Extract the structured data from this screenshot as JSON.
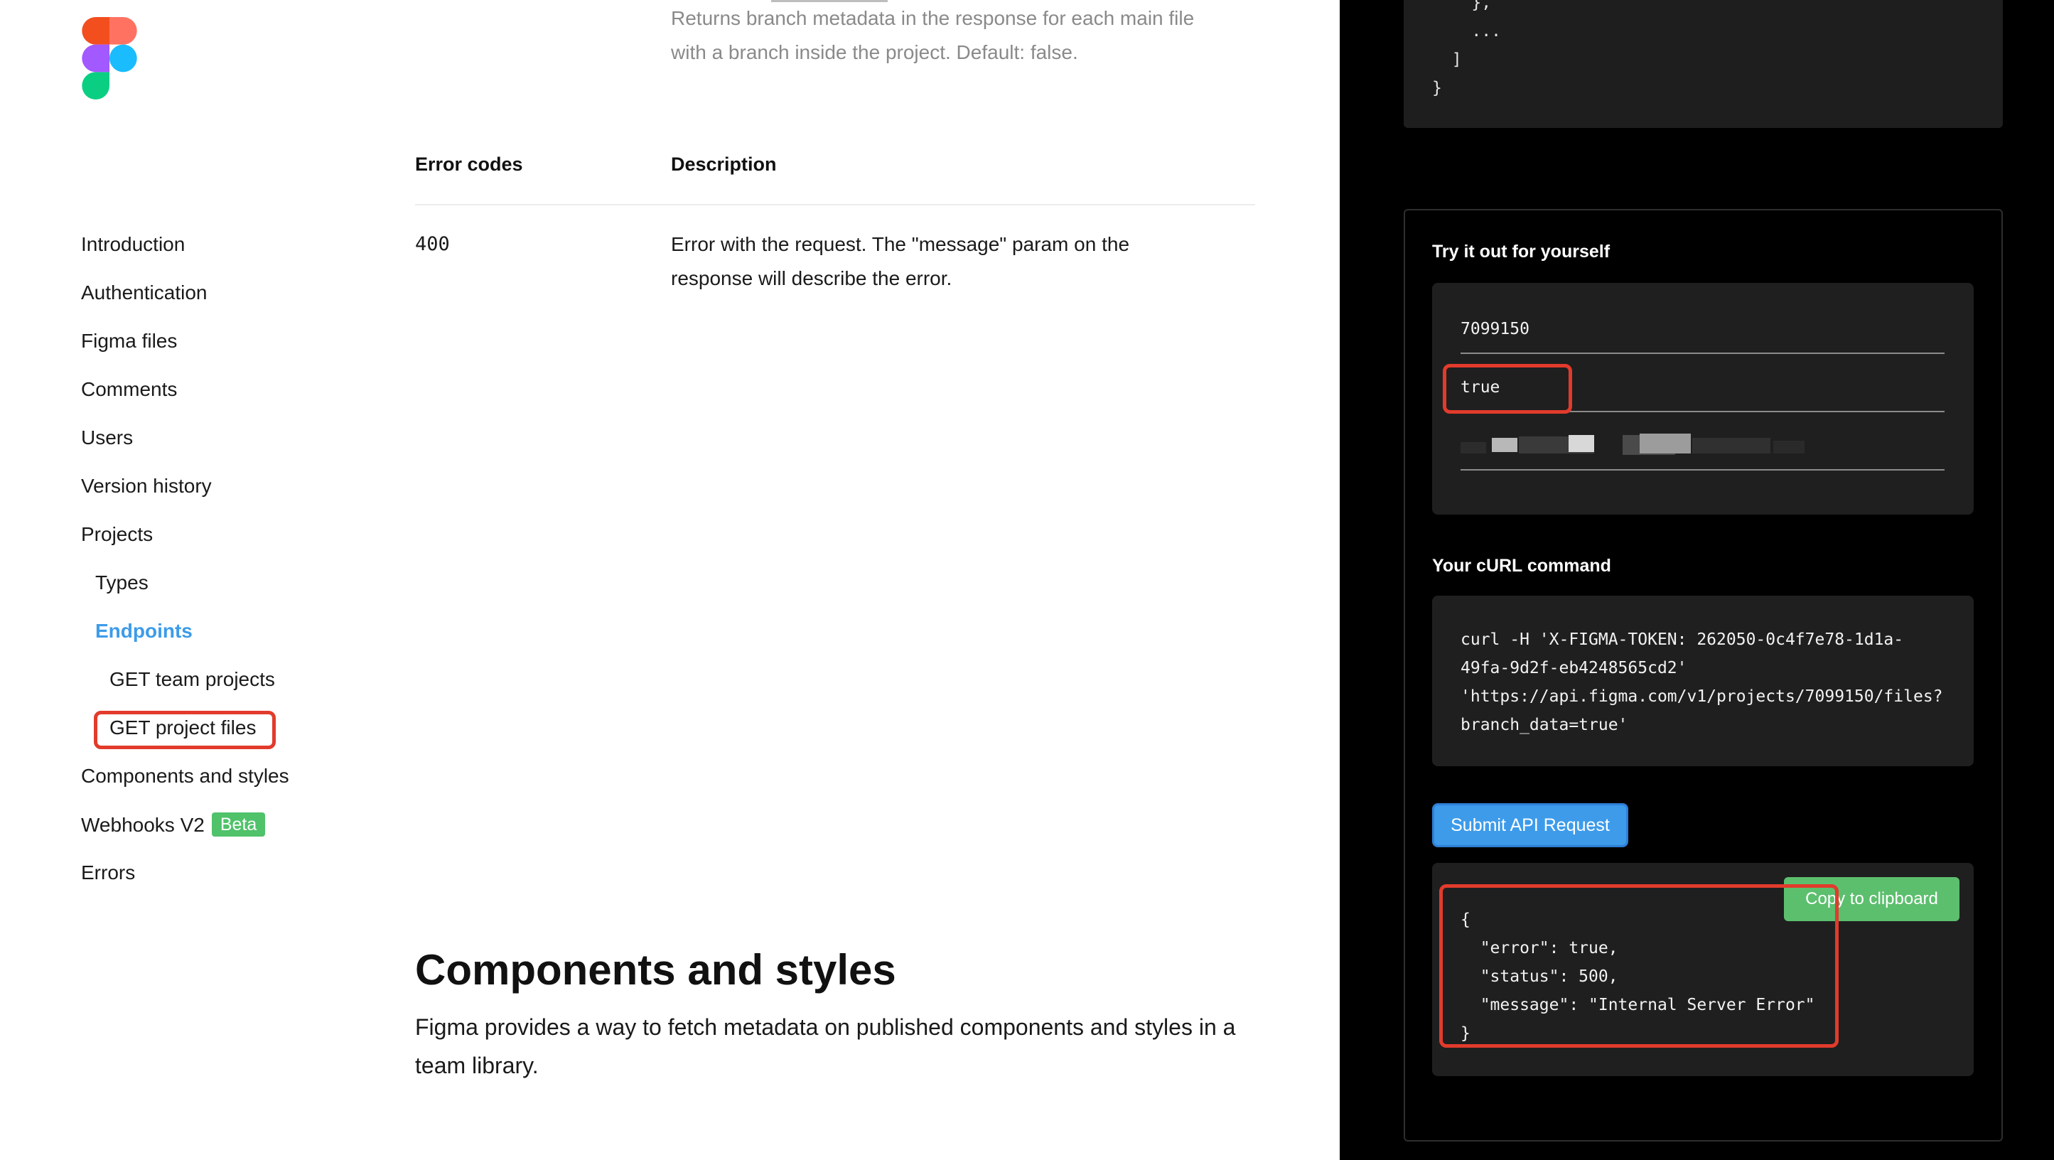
{
  "colors": {
    "accent": "#3d9bea",
    "highlight": "#e23b2c",
    "beta": "#4fc26a",
    "copy": "#5cbf6e"
  },
  "logo": {
    "icon": "figma-logo-icon"
  },
  "sidebar": {
    "items": [
      {
        "label": "Introduction"
      },
      {
        "label": "Authentication"
      },
      {
        "label": "Figma files"
      },
      {
        "label": "Comments"
      },
      {
        "label": "Users"
      },
      {
        "label": "Version history"
      },
      {
        "label": "Projects"
      },
      {
        "label": "Types"
      },
      {
        "label": "Endpoints"
      },
      {
        "label": "GET team projects"
      },
      {
        "label": "GET project files"
      },
      {
        "label": "Components and styles"
      },
      {
        "label": "Webhooks V2",
        "badge": "Beta"
      },
      {
        "label": "Errors"
      }
    ]
  },
  "main": {
    "param_desc_line1": "Returns branch metadata in the response for each main file",
    "param_desc_line2": "with a branch inside the project. Default: false.",
    "table": {
      "headers": [
        "Error codes",
        "Description"
      ],
      "rows": [
        {
          "code": "400",
          "desc_line1": "Error with the request. The \"message\" param on the",
          "desc_line2": "response will describe the error."
        }
      ]
    },
    "section": {
      "title": "Components and styles",
      "desc": "Figma provides a way to fetch metadata on published components and styles in a team library."
    }
  },
  "right": {
    "code_tail": "    },\n    ...\n  ]\n}",
    "try_label": "Try it out for yourself",
    "fields": [
      {
        "value": "7099150"
      },
      {
        "value": "true"
      }
    ],
    "curl_label": "Your cURL command",
    "curl_command": "curl -H 'X-FIGMA-TOKEN: 262050-0c4f7e78-1d1a-\n49fa-9d2f-eb4248565cd2'\n'https://api.figma.com/v1/projects/7099150/files?\nbranch_data=true'",
    "submit_label": "Submit API Request",
    "copy_label": "Copy to clipboard",
    "response": "{\n  \"error\": true,\n  \"status\": 500,\n  \"message\": \"Internal Server Error\"\n}"
  }
}
